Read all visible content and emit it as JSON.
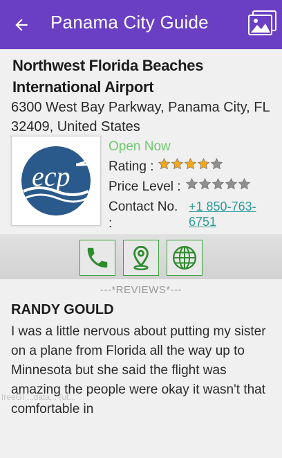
{
  "appbar": {
    "title": "Panama City Guide",
    "back_icon": "arrow-left-icon",
    "gallery_icon": "image-gallery-icon",
    "color": "#6a3fc4"
  },
  "place": {
    "name": "Northwest Florida Beaches International Airport",
    "address": "6300 West Bay Parkway, Panama City, FL 32409, United States",
    "logo_text": "ecp",
    "status": "Open Now",
    "status_color": "#6fc96f",
    "rating_label": "Rating :",
    "rating_value": 4,
    "rating_max": 5,
    "price_label": "Price Level :",
    "price_value": 0,
    "price_max": 5,
    "contact_label": "Contact No. :",
    "contact_phone": "+1 850-763-6751"
  },
  "actions": [
    {
      "name": "call-button",
      "icon": "phone-icon"
    },
    {
      "name": "map-button",
      "icon": "location-pin-icon"
    },
    {
      "name": "website-button",
      "icon": "globe-icon"
    }
  ],
  "reviews": {
    "header": "---*REVIEWS*---",
    "items": [
      {
        "author": "RANDY GOULD",
        "text": "I was a little nervous about putting my sister on a plane from Florida all the way up to Minnesota but she said the flight was amazing the people were okay it wasn't that comfortable in"
      }
    ]
  },
  "watermark": "freeGI ...data... (ut..."
}
